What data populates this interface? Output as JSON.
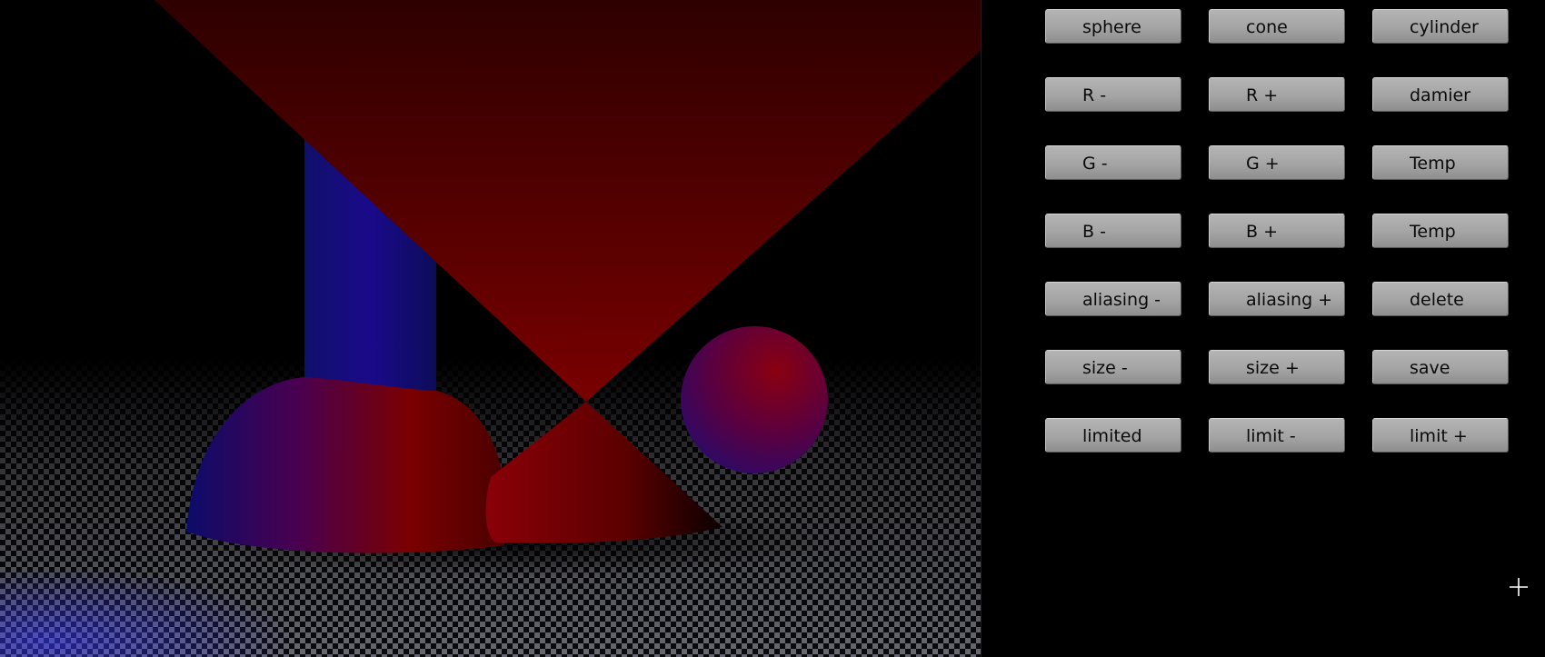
{
  "scene": {
    "objects": [
      "sphere",
      "cone",
      "cylinder"
    ],
    "colors": {
      "cone_red": "#6a0000",
      "sphere_red": "#8a0010",
      "cylinder_blue": "#1a0a7a",
      "floor_light": "#6e6e78",
      "floor_dark": "#0a0a0a",
      "background": "#000000"
    }
  },
  "panel": {
    "rows": [
      [
        "sphere",
        "cone",
        "cylinder"
      ],
      [
        "R -",
        "R +",
        "damier"
      ],
      [
        "G -",
        "G +",
        "Temp"
      ],
      [
        "B -",
        "B +",
        "Temp"
      ],
      [
        "aliasing -",
        "aliasing +",
        "delete"
      ],
      [
        "size -",
        "size +",
        "save"
      ],
      [
        "limited",
        "limit -",
        "limit +"
      ]
    ]
  },
  "cursor": {
    "icon": "crosshair-cursor-icon"
  }
}
